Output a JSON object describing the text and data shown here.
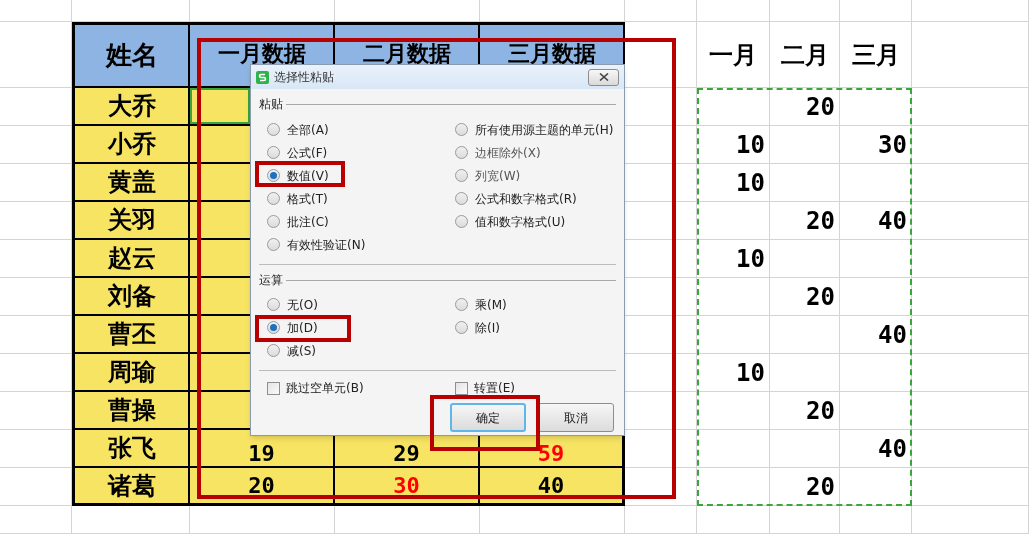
{
  "main_table": {
    "columns": [
      "姓名",
      "一月数据",
      "二月数据",
      "三月数据"
    ],
    "rows": [
      {
        "name": "大乔",
        "selected": true
      },
      {
        "name": "小乔",
        "selected": false
      },
      {
        "name": "黄盖",
        "selected": false
      },
      {
        "name": "关羽",
        "selected": false
      },
      {
        "name": "赵云",
        "selected": false
      },
      {
        "name": "刘备",
        "selected": false
      },
      {
        "name": "曹丕",
        "selected": false
      },
      {
        "name": "周瑜",
        "selected": false
      },
      {
        "name": "曹操",
        "selected": false
      },
      {
        "name": "张飞",
        "selected": false,
        "values": [
          {
            "text": "19",
            "color": "#000000"
          },
          {
            "text": "29",
            "color": "#000000"
          },
          {
            "text": "59",
            "color": "#ff0000"
          }
        ]
      },
      {
        "name": "诸葛",
        "selected": false,
        "values": [
          {
            "text": "20",
            "color": "#000000"
          },
          {
            "text": "30",
            "color": "#ff0000"
          },
          {
            "text": "40",
            "color": "#000000"
          }
        ]
      }
    ]
  },
  "copied_table": {
    "columns": [
      "一月",
      "二月",
      "三月"
    ],
    "rows": [
      [
        null,
        "20",
        null
      ],
      [
        "10",
        null,
        "30"
      ],
      [
        "10",
        null,
        null
      ],
      [
        null,
        "20",
        "40"
      ],
      [
        "10",
        null,
        null
      ],
      [
        null,
        "20",
        null
      ],
      [
        null,
        null,
        "40"
      ],
      [
        "10",
        null,
        null
      ],
      [
        null,
        "20",
        null
      ],
      [
        null,
        null,
        "40"
      ],
      [
        null,
        "20",
        null
      ]
    ]
  },
  "dialog": {
    "title": "选择性粘贴",
    "paste": {
      "label": "粘贴",
      "options": [
        {
          "label": "全部(A)",
          "selected": false,
          "disabled": false
        },
        {
          "label": "公式(F)",
          "selected": false,
          "disabled": false
        },
        {
          "label": "数值(V)",
          "selected": true,
          "disabled": false
        },
        {
          "label": "格式(T)",
          "selected": false,
          "disabled": false
        },
        {
          "label": "批注(C)",
          "selected": false,
          "disabled": false
        },
        {
          "label": "有效性验证(N)",
          "selected": false,
          "disabled": false
        },
        {
          "label": "所有使用源主题的单元(H)",
          "selected": false,
          "disabled": false
        },
        {
          "label": "边框除外(X)",
          "selected": false,
          "disabled": true
        },
        {
          "label": "列宽(W)",
          "selected": false,
          "disabled": true
        },
        {
          "label": "公式和数字格式(R)",
          "selected": false,
          "disabled": false
        },
        {
          "label": "值和数字格式(U)",
          "selected": false,
          "disabled": false
        }
      ]
    },
    "operation": {
      "label": "运算",
      "options": [
        {
          "label": "无(O)",
          "selected": false
        },
        {
          "label": "加(D)",
          "selected": true
        },
        {
          "label": "减(S)",
          "selected": false
        },
        {
          "label": "乘(M)",
          "selected": false
        },
        {
          "label": "除(I)",
          "selected": false
        }
      ]
    },
    "checkboxes": [
      {
        "label": "跳过空单元(B)",
        "checked": false
      },
      {
        "label": "转置(E)",
        "checked": false
      }
    ],
    "buttons": [
      {
        "label": "确定",
        "default": true
      },
      {
        "label": "取消",
        "default": false
      }
    ]
  }
}
